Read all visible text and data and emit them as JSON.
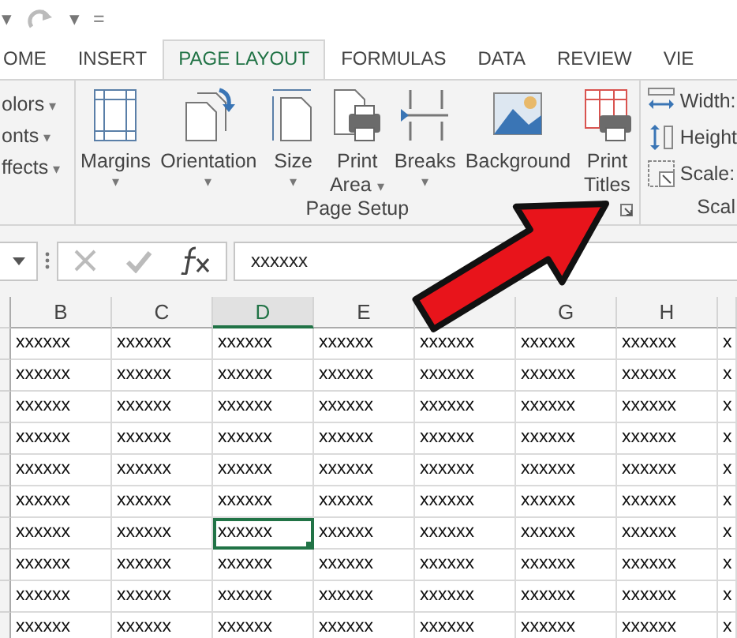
{
  "quick_access": {
    "undo_caret": "▾",
    "redo_caret": "▾",
    "customize": "="
  },
  "tabs": [
    {
      "label": "OME",
      "selected": false
    },
    {
      "label": "INSERT",
      "selected": false
    },
    {
      "label": "PAGE LAYOUT",
      "selected": true
    },
    {
      "label": "FORMULAS",
      "selected": false
    },
    {
      "label": "DATA",
      "selected": false
    },
    {
      "label": "REVIEW",
      "selected": false
    },
    {
      "label": "VIE",
      "selected": false
    }
  ],
  "themes_group": {
    "items": [
      {
        "label": "olors",
        "caret": "▾"
      },
      {
        "label": "onts",
        "caret": "▾"
      },
      {
        "label": "ffects",
        "caret": "▾"
      }
    ]
  },
  "page_setup": {
    "label": "Page Setup",
    "buttons": [
      {
        "kind": "margins",
        "lines": [
          "Margins"
        ],
        "caret": "▾"
      },
      {
        "kind": "orientation",
        "lines": [
          "Orientation"
        ],
        "caret": "▾"
      },
      {
        "kind": "size",
        "lines": [
          "Size"
        ],
        "caret": "▾"
      },
      {
        "kind": "print_area",
        "lines": [
          "Print",
          "Area"
        ],
        "caret": "▾"
      },
      {
        "kind": "breaks",
        "lines": [
          "Breaks"
        ],
        "caret": "▾"
      },
      {
        "kind": "background",
        "lines": [
          "Background"
        ]
      },
      {
        "kind": "print_titles",
        "lines": [
          "Print",
          "Titles"
        ]
      }
    ]
  },
  "scale_group": {
    "label": "Scal",
    "items": [
      {
        "kind": "width",
        "label": "Width:"
      },
      {
        "kind": "height",
        "label": "Height"
      },
      {
        "kind": "scale",
        "label": "Scale:"
      }
    ]
  },
  "formula_bar": {
    "value": "xxxxxx"
  },
  "sheet": {
    "columns": [
      {
        "label": "B",
        "selected": false
      },
      {
        "label": "C",
        "selected": false
      },
      {
        "label": "D",
        "selected": true
      },
      {
        "label": "E",
        "selected": false
      },
      {
        "selected": false
      },
      {
        "label": "G",
        "selected": false
      },
      {
        "label": "H",
        "selected": false
      },
      {
        "selected": false
      }
    ],
    "rows": [
      [
        {
          "text": "xxxxxx",
          "selected": false
        },
        {
          "text": "xxxxxx",
          "selected": false
        },
        {
          "text": "xxxxxx",
          "selected": false
        },
        {
          "text": "xxxxxx",
          "selected": false
        },
        {
          "text": "xxxxxx",
          "selected": false
        },
        {
          "text": "xxxxxx",
          "selected": false
        },
        {
          "text": "xxxxxx",
          "selected": false
        },
        {
          "text": "x",
          "selected": false
        }
      ],
      [
        {
          "text": "xxxxxx",
          "selected": false
        },
        {
          "text": "xxxxxx",
          "selected": false
        },
        {
          "text": "xxxxxx",
          "selected": false
        },
        {
          "text": "xxxxxx",
          "selected": false
        },
        {
          "text": "xxxxxx",
          "selected": false
        },
        {
          "text": "xxxxxx",
          "selected": false
        },
        {
          "text": "xxxxxx",
          "selected": false
        },
        {
          "text": "x",
          "selected": false
        }
      ],
      [
        {
          "text": "xxxxxx",
          "selected": false
        },
        {
          "text": "xxxxxx",
          "selected": false
        },
        {
          "text": "xxxxxx",
          "selected": false
        },
        {
          "text": "xxxxxx",
          "selected": false
        },
        {
          "text": "xxxxxx",
          "selected": false
        },
        {
          "text": "xxxxxx",
          "selected": false
        },
        {
          "text": "xxxxxx",
          "selected": false
        },
        {
          "text": "x",
          "selected": false
        }
      ],
      [
        {
          "text": "xxxxxx",
          "selected": false
        },
        {
          "text": "xxxxxx",
          "selected": false
        },
        {
          "text": "xxxxxx",
          "selected": false
        },
        {
          "text": "xxxxxx",
          "selected": false
        },
        {
          "text": "xxxxxx",
          "selected": false
        },
        {
          "text": "xxxxxx",
          "selected": false
        },
        {
          "text": "xxxxxx",
          "selected": false
        },
        {
          "text": "x",
          "selected": false
        }
      ],
      [
        {
          "text": "xxxxxx",
          "selected": false
        },
        {
          "text": "xxxxxx",
          "selected": false
        },
        {
          "text": "xxxxxx",
          "selected": false
        },
        {
          "text": "xxxxxx",
          "selected": false
        },
        {
          "text": "xxxxxx",
          "selected": false
        },
        {
          "text": "xxxxxx",
          "selected": false
        },
        {
          "text": "xxxxxx",
          "selected": false
        },
        {
          "text": "x",
          "selected": false
        }
      ],
      [
        {
          "text": "xxxxxx",
          "selected": false
        },
        {
          "text": "xxxxxx",
          "selected": false
        },
        {
          "text": "xxxxxx",
          "selected": false
        },
        {
          "text": "xxxxxx",
          "selected": false
        },
        {
          "text": "xxxxxx",
          "selected": false
        },
        {
          "text": "xxxxxx",
          "selected": false
        },
        {
          "text": "xxxxxx",
          "selected": false
        },
        {
          "text": "x",
          "selected": false
        }
      ],
      [
        {
          "text": "xxxxxx",
          "selected": false
        },
        {
          "text": "xxxxxx",
          "selected": false
        },
        {
          "text": "xxxxxx",
          "selected": true
        },
        {
          "text": "xxxxxx",
          "selected": false
        },
        {
          "text": "xxxxxx",
          "selected": false
        },
        {
          "text": "xxxxxx",
          "selected": false
        },
        {
          "text": "xxxxxx",
          "selected": false
        },
        {
          "text": "x",
          "selected": false
        }
      ],
      [
        {
          "text": "xxxxxx",
          "selected": false
        },
        {
          "text": "xxxxxx",
          "selected": false
        },
        {
          "text": "xxxxxx",
          "selected": false
        },
        {
          "text": "xxxxxx",
          "selected": false
        },
        {
          "text": "xxxxxx",
          "selected": false
        },
        {
          "text": "xxxxxx",
          "selected": false
        },
        {
          "text": "xxxxxx",
          "selected": false
        },
        {
          "text": "x",
          "selected": false
        }
      ],
      [
        {
          "text": "xxxxxx",
          "selected": false
        },
        {
          "text": "xxxxxx",
          "selected": false
        },
        {
          "text": "xxxxxx",
          "selected": false
        },
        {
          "text": "xxxxxx",
          "selected": false
        },
        {
          "text": "xxxxxx",
          "selected": false
        },
        {
          "text": "xxxxxx",
          "selected": false
        },
        {
          "text": "xxxxxx",
          "selected": false
        },
        {
          "text": "x",
          "selected": false
        }
      ],
      [
        {
          "text": "xxxxxx",
          "selected": false
        },
        {
          "text": "xxxxxx",
          "selected": false
        },
        {
          "text": "xxxxxx",
          "selected": false
        },
        {
          "text": "xxxxxx",
          "selected": false
        },
        {
          "text": "xxxxxx",
          "selected": false
        },
        {
          "text": "xxxxxx",
          "selected": false
        },
        {
          "text": "xxxxxx",
          "selected": false
        },
        {
          "text": "x",
          "selected": false
        }
      ]
    ]
  },
  "annotation": {
    "kind": "arrow"
  }
}
